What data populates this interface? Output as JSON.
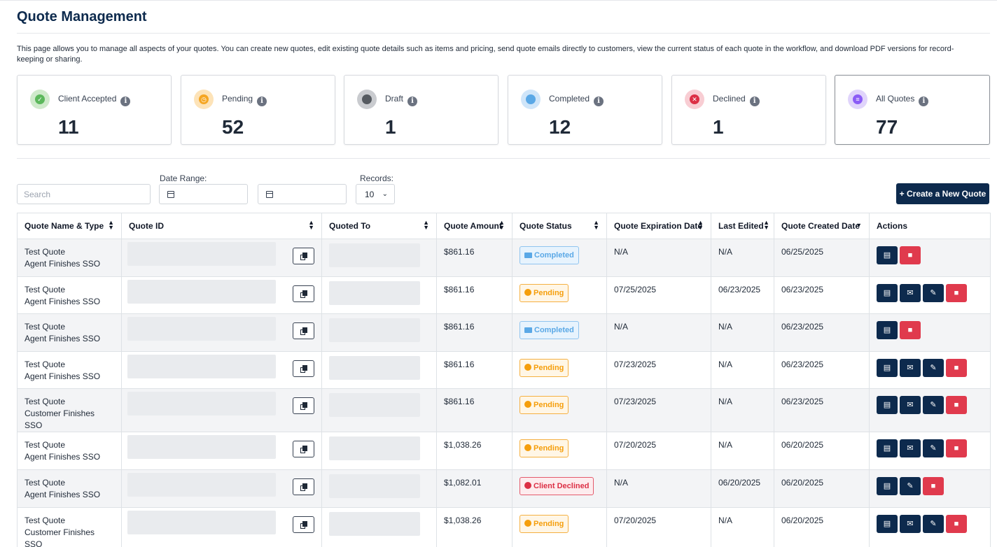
{
  "title": "Quote Management",
  "description": "This page allows you to manage all aspects of your quotes. You can create new quotes, edit existing quote details such as items and pricing, send quote emails directly to customers, view the current status of each quote in the workflow, and download PDF versions for record-keeping or sharing.",
  "cards": [
    {
      "label": "Client Accepted",
      "count": "11",
      "icon": "check-circle-icon",
      "color": "#5cb85c",
      "bg": "#cfeacb"
    },
    {
      "label": "Pending",
      "count": "52",
      "icon": "clock-icon",
      "color": "#f5a623",
      "bg": "#fde3b8"
    },
    {
      "label": "Draft",
      "count": "1",
      "icon": "folder-open-icon",
      "color": "#555a60",
      "bg": "#c9cbcf"
    },
    {
      "label": "Completed",
      "count": "12",
      "icon": "folder-icon",
      "color": "#5aa8e6",
      "bg": "#cfe5f9"
    },
    {
      "label": "Declined",
      "count": "1",
      "icon": "x-circle-icon",
      "color": "#dc2f45",
      "bg": "#f8cdd3"
    },
    {
      "label": "All Quotes",
      "count": "77",
      "icon": "document-icon",
      "color": "#8b5cf6",
      "bg": "#e0d4fb"
    }
  ],
  "filters": {
    "search_placeholder": "Search",
    "date_range_label": "Date Range:",
    "records_label": "Records:",
    "records_value": "10"
  },
  "create_button": "+ Create a New Quote",
  "columns": [
    "Quote Name & Type",
    "Quote ID",
    "Quoted To",
    "Quote Amount",
    "Quote Status",
    "Quote Expiration Date",
    "Last Edited",
    "Quote Created Date",
    "Actions"
  ],
  "rows": [
    {
      "name": "Test Quote",
      "type": "Agent Finishes SSO",
      "amount": "$861.16",
      "status": "Completed",
      "status_key": "completed",
      "expiration": "N/A",
      "edited": "N/A",
      "created": "06/25/2025",
      "actions": [
        "pdf",
        "delete"
      ]
    },
    {
      "name": "Test Quote",
      "type": "Agent Finishes SSO",
      "amount": "$861.16",
      "status": "Pending",
      "status_key": "pending",
      "expiration": "07/25/2025",
      "edited": "06/23/2025",
      "created": "06/23/2025",
      "actions": [
        "pdf",
        "email",
        "edit",
        "delete"
      ]
    },
    {
      "name": "Test Quote",
      "type": "Agent Finishes SSO",
      "amount": "$861.16",
      "status": "Completed",
      "status_key": "completed",
      "expiration": "N/A",
      "edited": "N/A",
      "created": "06/23/2025",
      "actions": [
        "pdf",
        "delete"
      ]
    },
    {
      "name": "Test Quote",
      "type": "Agent Finishes SSO",
      "amount": "$861.16",
      "status": "Pending",
      "status_key": "pending",
      "expiration": "07/23/2025",
      "edited": "N/A",
      "created": "06/23/2025",
      "actions": [
        "pdf",
        "email",
        "edit",
        "delete"
      ]
    },
    {
      "name": "Test Quote",
      "type": "Customer Finishes SSO",
      "amount": "$861.16",
      "status": "Pending",
      "status_key": "pending",
      "expiration": "07/23/2025",
      "edited": "N/A",
      "created": "06/23/2025",
      "actions": [
        "pdf",
        "email",
        "edit",
        "delete"
      ]
    },
    {
      "name": "Test Quote",
      "type": "Agent Finishes SSO",
      "amount": "$1,038.26",
      "status": "Pending",
      "status_key": "pending",
      "expiration": "07/20/2025",
      "edited": "N/A",
      "created": "06/20/2025",
      "actions": [
        "pdf",
        "email",
        "edit",
        "delete"
      ]
    },
    {
      "name": "Test Quote",
      "type": "Agent Finishes SSO",
      "amount": "$1,082.01",
      "status": "Client Declined",
      "status_key": "declined",
      "expiration": "N/A",
      "edited": "06/20/2025",
      "created": "06/20/2025",
      "actions": [
        "pdf",
        "edit",
        "delete"
      ]
    },
    {
      "name": "Test Quote",
      "type": "Customer Finishes SSO",
      "amount": "$1,038.26",
      "status": "Pending",
      "status_key": "pending",
      "expiration": "07/20/2025",
      "edited": "N/A",
      "created": "06/20/2025",
      "actions": [
        "pdf",
        "email",
        "edit",
        "delete"
      ]
    }
  ]
}
